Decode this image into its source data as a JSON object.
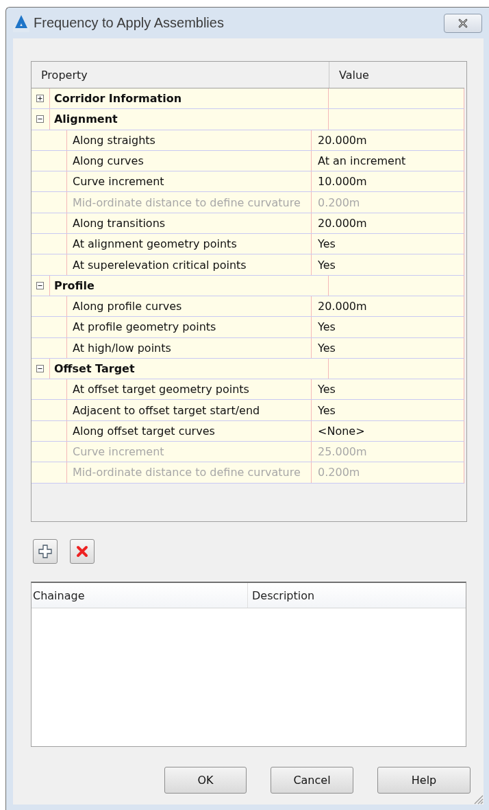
{
  "window": {
    "title": "Frequency to Apply Assemblies"
  },
  "property_grid": {
    "columns": [
      "Property",
      "Value"
    ],
    "groups": [
      {
        "name": "Corridor Information",
        "expanded": false
      },
      {
        "name": "Alignment",
        "expanded": true,
        "children": [
          {
            "property": "Along straights",
            "value": "20.000m",
            "disabled": false
          },
          {
            "property": "Along curves",
            "value": "At an increment",
            "disabled": false
          },
          {
            "property": "Curve increment",
            "value": "10.000m",
            "disabled": false
          },
          {
            "property": "Mid-ordinate distance to define curvature",
            "value": "0.200m",
            "disabled": true
          },
          {
            "property": "Along transitions",
            "value": "20.000m",
            "disabled": false
          },
          {
            "property": "At alignment geometry points",
            "value": "Yes",
            "disabled": false
          },
          {
            "property": "At superelevation critical points",
            "value": "Yes",
            "disabled": false
          }
        ]
      },
      {
        "name": "Profile",
        "expanded": true,
        "children": [
          {
            "property": "Along profile curves",
            "value": "20.000m",
            "disabled": false
          },
          {
            "property": "At profile geometry points",
            "value": "Yes",
            "disabled": false
          },
          {
            "property": "At high/low points",
            "value": "Yes",
            "disabled": false
          }
        ]
      },
      {
        "name": "Offset Target",
        "expanded": true,
        "children": [
          {
            "property": "At offset target geometry points",
            "value": "Yes",
            "disabled": false
          },
          {
            "property": "Adjacent to offset target start/end",
            "value": "Yes",
            "disabled": false
          },
          {
            "property": "Along offset target curves",
            "value": "<None>",
            "disabled": false
          },
          {
            "property": "Curve increment",
            "value": "25.000m",
            "disabled": true
          },
          {
            "property": "Mid-ordinate distance to define curvature",
            "value": "0.200m",
            "disabled": true
          }
        ]
      }
    ]
  },
  "stations_table": {
    "columns": [
      "Chainage",
      "Description"
    ]
  },
  "buttons": [
    "OK",
    "Cancel",
    "Help"
  ]
}
